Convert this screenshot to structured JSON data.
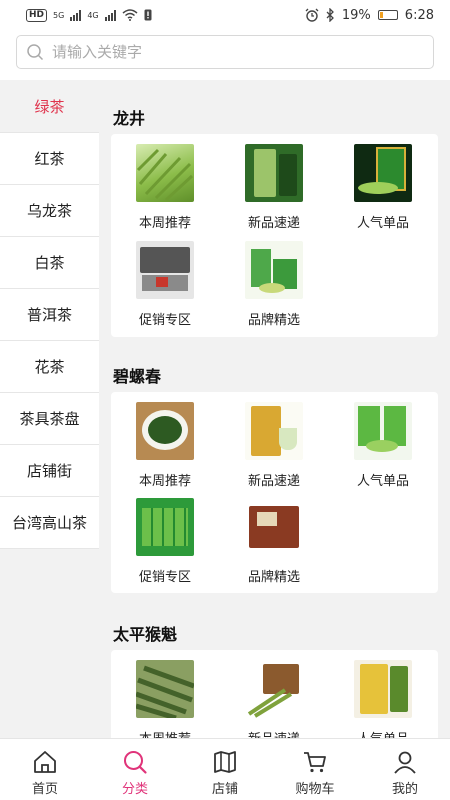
{
  "status_bar": {
    "network": "HD",
    "signal_a": "5G",
    "signal_b": "4G",
    "battery": "19%",
    "battery_level": 0.19,
    "time": "6:28"
  },
  "search": {
    "placeholder": "请输入关键字"
  },
  "categories": [
    {
      "label": "绿茶",
      "active": true
    },
    {
      "label": "红茶"
    },
    {
      "label": "乌龙茶"
    },
    {
      "label": "白茶"
    },
    {
      "label": "普洱茶"
    },
    {
      "label": "花茶"
    },
    {
      "label": "茶具茶盘"
    },
    {
      "label": "店铺街"
    },
    {
      "label": "台湾高山茶"
    }
  ],
  "sections": [
    {
      "title": "龙井",
      "items": [
        "本周推荐",
        "新品速递",
        "人气单品",
        "促销专区",
        "品牌精选"
      ]
    },
    {
      "title": "碧螺春",
      "items": [
        "本周推荐",
        "新品速递",
        "人气单品",
        "促销专区",
        "品牌精选"
      ]
    },
    {
      "title": "太平猴魁",
      "items": [
        "本周推荐",
        "新品速递",
        "人气单品"
      ]
    }
  ],
  "bottom_nav": [
    {
      "label": "首页",
      "icon": "home-icon"
    },
    {
      "label": "分类",
      "icon": "category-search-icon",
      "active": true
    },
    {
      "label": "店铺",
      "icon": "store-icon"
    },
    {
      "label": "购物车",
      "icon": "cart-icon"
    },
    {
      "label": "我的",
      "icon": "user-icon"
    }
  ],
  "colors": {
    "accent_red": "#e0344d",
    "nav_active": "#e0347a"
  }
}
